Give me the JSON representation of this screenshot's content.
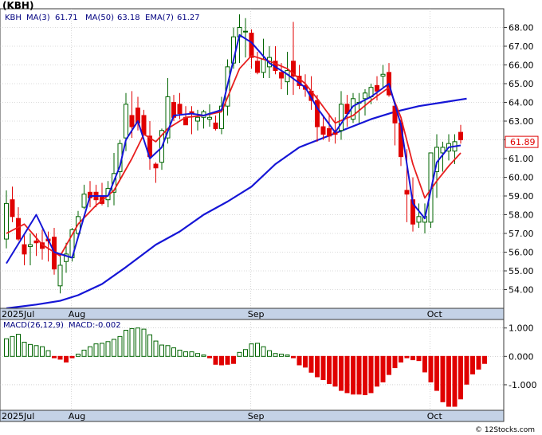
{
  "symbol": "(KBH)",
  "watermark": "© 12Stocks.com",
  "price_legend": {
    "ticker": "KBH",
    "ma3": "MA(3)",
    "ma3_value": "61.71",
    "ma50": "MA(50)",
    "ma50_value": "63.18",
    "ema7": "EMA(7)",
    "ema7_value": "61.27"
  },
  "macd_legend": {
    "label": "MACD(26,12,9)",
    "value": "MACD:-0.002"
  },
  "last_price_tag": "61.89",
  "colors": {
    "up": "#006400",
    "down": "#e00000",
    "ma_blue": "#1515d6",
    "ema_red": "#e81e1e",
    "axis_bg": "#c4d2e6",
    "frame": "#3a3a3a"
  },
  "chart_data": [
    {
      "type": "candlestick",
      "ylim": [
        53,
        69
      ],
      "y_ticks": [
        "54.00",
        "55.00",
        "56.00",
        "57.00",
        "58.00",
        "59.00",
        "60.00",
        "61.00",
        "62.00",
        "63.00",
        "64.00",
        "65.00",
        "66.00",
        "67.00",
        "68.00"
      ],
      "x_tick_labels": [
        {
          "label": "2025Jul",
          "index": 0
        },
        {
          "label": "Aug",
          "index": 11
        },
        {
          "label": "Sep",
          "index": 41
        },
        {
          "label": "Oct",
          "index": 71
        }
      ],
      "candles": [
        [
          56.7,
          59.3,
          56.2,
          58.6
        ],
        [
          58.8,
          59.5,
          57.6,
          57.9
        ],
        [
          57.8,
          58.4,
          56.6,
          56.7
        ],
        [
          56.4,
          57.0,
          55.3,
          55.9
        ],
        [
          56.3,
          57.0,
          55.3,
          56.4
        ],
        [
          56.6,
          57.0,
          55.8,
          56.5
        ],
        [
          56.5,
          57.2,
          55.6,
          56.2
        ],
        [
          56.7,
          57.1,
          55.5,
          56.6
        ],
        [
          56.8,
          57.3,
          54.8,
          55.1
        ],
        [
          54.2,
          55.9,
          53.8,
          55.3
        ],
        [
          55.5,
          56.5,
          54.9,
          55.9
        ],
        [
          55.7,
          57.3,
          55.5,
          57.2
        ],
        [
          57.0,
          58.2,
          56.9,
          57.9
        ],
        [
          58.4,
          59.6,
          58.3,
          59.1
        ],
        [
          59.2,
          59.8,
          58.4,
          58.9
        ],
        [
          59.2,
          59.6,
          58.4,
          58.8
        ],
        [
          59.0,
          59.7,
          58.5,
          58.6
        ],
        [
          58.8,
          59.8,
          58.4,
          59.4
        ],
        [
          59.2,
          61.3,
          58.5,
          60.2
        ],
        [
          60.3,
          62.0,
          59.8,
          61.8
        ],
        [
          62.1,
          64.5,
          61.4,
          63.9
        ],
        [
          63.3,
          64.6,
          62.1,
          62.7
        ],
        [
          63.7,
          64.3,
          62.5,
          62.9
        ],
        [
          63.3,
          63.6,
          62.3,
          62.3
        ],
        [
          62.2,
          63.0,
          60.4,
          61.1
        ],
        [
          60.7,
          60.8,
          59.7,
          60.5
        ],
        [
          60.8,
          62.6,
          60.4,
          62.5
        ],
        [
          62.1,
          65.3,
          61.8,
          64.3
        ],
        [
          64.0,
          64.4,
          63.0,
          63.2
        ],
        [
          63.9,
          64.5,
          63.1,
          63.4
        ],
        [
          63.2,
          63.8,
          62.8,
          62.8
        ],
        [
          63.5,
          63.8,
          62.3,
          63.4
        ],
        [
          63.0,
          63.6,
          62.5,
          63.2
        ],
        [
          63.2,
          63.6,
          62.6,
          63.5
        ],
        [
          63.1,
          63.9,
          62.7,
          63.2
        ],
        [
          62.9,
          63.3,
          62.5,
          62.6
        ],
        [
          62.6,
          64.3,
          62.3,
          63.8
        ],
        [
          63.8,
          66.3,
          63.3,
          65.9
        ],
        [
          66.1,
          68.0,
          65.8,
          67.5
        ],
        [
          67.5,
          68.7,
          66.1,
          68.0
        ],
        [
          67.8,
          68.5,
          66.4,
          67.8
        ],
        [
          67.7,
          67.9,
          65.8,
          66.4
        ],
        [
          66.2,
          66.7,
          65.5,
          65.6
        ],
        [
          65.6,
          67.4,
          65.3,
          66.3
        ],
        [
          65.9,
          67.0,
          65.3,
          66.4
        ],
        [
          66.2,
          67.0,
          65.5,
          65.7
        ],
        [
          65.6,
          66.1,
          64.7,
          65.3
        ],
        [
          65.1,
          66.7,
          64.4,
          65.7
        ],
        [
          66.2,
          68.3,
          64.4,
          65.4
        ],
        [
          65.4,
          66.0,
          64.7,
          64.9
        ],
        [
          64.9,
          65.5,
          64.3,
          64.7
        ],
        [
          64.6,
          65.4,
          63.6,
          64.1
        ],
        [
          64.1,
          64.4,
          61.9,
          62.7
        ],
        [
          62.7,
          63.2,
          62.0,
          62.3
        ],
        [
          62.6,
          63.4,
          61.9,
          62.2
        ],
        [
          62.4,
          63.2,
          61.8,
          62.3
        ],
        [
          62.5,
          64.6,
          62.0,
          63.9
        ],
        [
          63.9,
          64.4,
          62.7,
          63.4
        ],
        [
          63.1,
          64.5,
          62.9,
          64.2
        ],
        [
          64.0,
          64.5,
          62.9,
          64.0
        ],
        [
          64.2,
          64.7,
          63.3,
          64.5
        ],
        [
          64.3,
          65.0,
          63.9,
          64.8
        ],
        [
          64.9,
          65.4,
          64.1,
          64.6
        ],
        [
          65.4,
          66.0,
          64.8,
          65.5
        ],
        [
          65.6,
          66.1,
          64.3,
          64.4
        ],
        [
          63.8,
          64.0,
          61.7,
          62.9
        ],
        [
          62.9,
          63.2,
          60.6,
          61.1
        ],
        [
          59.3,
          61.5,
          57.6,
          59.1
        ],
        [
          58.8,
          60.0,
          57.1,
          57.5
        ],
        [
          57.6,
          58.6,
          57.3,
          57.9
        ],
        [
          57.6,
          58.6,
          57.0,
          57.9
        ],
        [
          57.6,
          61.2,
          57.3,
          61.3
        ],
        [
          60.3,
          62.3,
          58.9,
          61.6
        ],
        [
          61.3,
          61.9,
          60.3,
          61.6
        ],
        [
          61.4,
          62.3,
          60.9,
          61.8
        ],
        [
          61.4,
          62.3,
          60.7,
          61.9
        ],
        [
          62.4,
          62.8,
          61.8,
          62.0
        ]
      ],
      "ma3_line": [
        [
          0,
          55.4
        ],
        [
          5,
          58.0
        ],
        [
          8,
          56.0
        ],
        [
          11,
          55.7
        ],
        [
          14,
          59.0
        ],
        [
          17,
          59.0
        ],
        [
          19,
          60.6
        ],
        [
          20,
          62.0
        ],
        [
          22,
          63.0
        ],
        [
          24,
          61.0
        ],
        [
          26,
          61.6
        ],
        [
          28,
          63.3
        ],
        [
          31,
          63.4
        ],
        [
          33,
          63.3
        ],
        [
          36,
          63.6
        ],
        [
          39,
          67.6
        ],
        [
          41,
          67.2
        ],
        [
          44,
          66.1
        ],
        [
          47,
          65.5
        ],
        [
          50,
          64.8
        ],
        [
          52,
          63.7
        ],
        [
          55,
          62.4
        ],
        [
          58,
          63.8
        ],
        [
          61,
          64.3
        ],
        [
          64,
          65.0
        ],
        [
          66,
          62.8
        ],
        [
          68,
          58.6
        ],
        [
          70,
          57.8
        ],
        [
          72,
          60.8
        ],
        [
          74,
          61.6
        ],
        [
          76,
          61.7
        ]
      ],
      "ema7_line": [
        [
          0,
          57.0
        ],
        [
          3,
          57.5
        ],
        [
          6,
          56.4
        ],
        [
          9,
          55.8
        ],
        [
          12,
          57.5
        ],
        [
          15,
          58.5
        ],
        [
          18,
          59.3
        ],
        [
          21,
          61.0
        ],
        [
          23,
          62.3
        ],
        [
          25,
          61.9
        ],
        [
          27,
          62.6
        ],
        [
          30,
          63.2
        ],
        [
          33,
          63.3
        ],
        [
          36,
          63.5
        ],
        [
          39,
          65.8
        ],
        [
          41,
          66.5
        ],
        [
          44,
          66.2
        ],
        [
          47,
          65.8
        ],
        [
          50,
          65.0
        ],
        [
          52,
          64.2
        ],
        [
          55,
          62.9
        ],
        [
          58,
          63.3
        ],
        [
          61,
          64.1
        ],
        [
          64,
          64.8
        ],
        [
          66,
          63.2
        ],
        [
          68,
          60.7
        ],
        [
          70,
          58.9
        ],
        [
          72,
          59.8
        ],
        [
          74,
          60.6
        ],
        [
          76,
          61.3
        ]
      ],
      "ma50_line": [
        [
          0,
          53.0
        ],
        [
          5,
          53.2
        ],
        [
          9,
          53.4
        ],
        [
          12,
          53.7
        ],
        [
          16,
          54.3
        ],
        [
          20,
          55.2
        ],
        [
          25,
          56.4
        ],
        [
          29,
          57.1
        ],
        [
          33,
          58.0
        ],
        [
          37,
          58.7
        ],
        [
          41,
          59.5
        ],
        [
          45,
          60.7
        ],
        [
          49,
          61.6
        ],
        [
          53,
          62.1
        ],
        [
          57,
          62.6
        ],
        [
          61,
          63.1
        ],
        [
          65,
          63.5
        ],
        [
          69,
          63.8
        ],
        [
          73,
          64.0
        ],
        [
          77,
          64.2
        ]
      ]
    },
    {
      "type": "bar",
      "series_name": "MACD(26,12,9)",
      "ylim": [
        -1.9,
        1.3
      ],
      "y_ticks": [
        "1.000",
        "0.000",
        "-1.000"
      ],
      "values": [
        0.62,
        0.7,
        0.78,
        0.5,
        0.42,
        0.38,
        0.34,
        0.2,
        -0.05,
        -0.1,
        -0.2,
        -0.05,
        0.08,
        0.22,
        0.34,
        0.44,
        0.46,
        0.52,
        0.6,
        0.7,
        0.92,
        0.98,
        1.0,
        0.96,
        0.76,
        0.54,
        0.4,
        0.38,
        0.3,
        0.22,
        0.16,
        0.16,
        0.1,
        0.05,
        -0.05,
        -0.28,
        -0.3,
        -0.28,
        -0.25,
        0.14,
        0.24,
        0.44,
        0.46,
        0.34,
        0.2,
        0.1,
        0.08,
        0.05,
        -0.05,
        -0.3,
        -0.38,
        -0.56,
        -0.72,
        -0.82,
        -0.96,
        -1.05,
        -1.2,
        -1.28,
        -1.33,
        -1.33,
        -1.35,
        -1.28,
        -1.05,
        -0.9,
        -0.64,
        -0.4,
        -0.2,
        -0.05,
        -0.12,
        -0.15,
        -0.55,
        -0.9,
        -1.2,
        -1.6,
        -1.76,
        -1.76,
        -1.5,
        -0.98,
        -0.62,
        -0.45,
        -0.25
      ]
    }
  ]
}
